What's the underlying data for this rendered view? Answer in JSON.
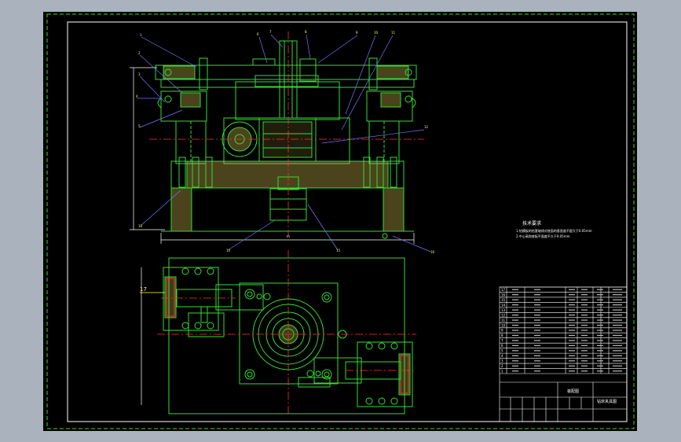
{
  "colors": {
    "outer_bg": "#aab3bd",
    "sheet_bg": "#000000",
    "frame": "#ffffff",
    "dashed_border": "#39d839",
    "part": "#33dd33",
    "center_line": "#ff3333",
    "hatch": "#d8c050",
    "leader": "#7777ff",
    "text": "#ffffff",
    "label": "#ffff66"
  },
  "drawing": {
    "part_label_17": "17",
    "dimension_center": "m",
    "tech_req_title": "技术要求",
    "tech_req_line1": "1.钻模板的钻套轴线对底面的垂直度不超大于0.05mm",
    "tech_req_line2": "2.中心高和底板平面度不大于0.05mm",
    "balloons": [
      "1",
      "2",
      "3",
      "4",
      "5",
      "6",
      "7",
      "8",
      "9",
      "10",
      "11",
      "12",
      "13",
      "14",
      "15",
      "16"
    ],
    "title_block": {
      "drawing_title": "钻床夹具图",
      "assembly_label": "装配图",
      "bom_rows": [
        "1",
        "2",
        "3",
        "4",
        "5",
        "6",
        "7",
        "8",
        "9",
        "10",
        "11",
        "12",
        "13",
        "14",
        "15",
        "16",
        "17"
      ]
    }
  }
}
